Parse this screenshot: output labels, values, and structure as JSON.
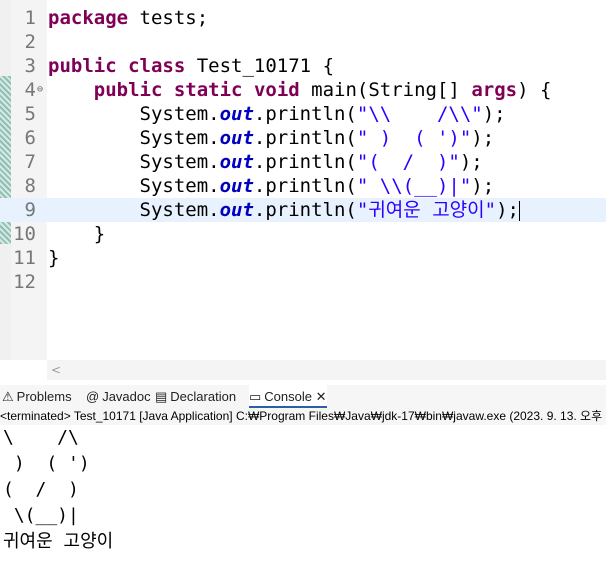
{
  "editor": {
    "lines": [
      {
        "num": "1",
        "tokens": [
          {
            "t": "package",
            "c": "kw"
          },
          {
            "t": " tests;"
          }
        ]
      },
      {
        "num": "2",
        "tokens": []
      },
      {
        "num": "3",
        "tokens": [
          {
            "t": "public",
            "c": "kw"
          },
          {
            "t": " "
          },
          {
            "t": "class",
            "c": "kw"
          },
          {
            "t": " Test_10171 {"
          }
        ]
      },
      {
        "num": "4",
        "fold": true,
        "tokens": [
          {
            "t": "    "
          },
          {
            "t": "public",
            "c": "kw"
          },
          {
            "t": " "
          },
          {
            "t": "static",
            "c": "kw"
          },
          {
            "t": " "
          },
          {
            "t": "void",
            "c": "kw"
          },
          {
            "t": " main(String[] "
          },
          {
            "t": "args",
            "c": "kw"
          },
          {
            "t": ") {"
          }
        ]
      },
      {
        "num": "5",
        "tokens": [
          {
            "t": "        System."
          },
          {
            "t": "out",
            "c": "fld"
          },
          {
            "t": ".println("
          },
          {
            "t": "\"\\\\    /\\\\\"",
            "c": "str"
          },
          {
            "t": ");"
          }
        ]
      },
      {
        "num": "6",
        "tokens": [
          {
            "t": "        System."
          },
          {
            "t": "out",
            "c": "fld"
          },
          {
            "t": ".println("
          },
          {
            "t": "\" )  ( ')\"",
            "c": "str"
          },
          {
            "t": ");"
          }
        ]
      },
      {
        "num": "7",
        "tokens": [
          {
            "t": "        System."
          },
          {
            "t": "out",
            "c": "fld"
          },
          {
            "t": ".println("
          },
          {
            "t": "\"(  /  )\"",
            "c": "str"
          },
          {
            "t": ");"
          }
        ]
      },
      {
        "num": "8",
        "tokens": [
          {
            "t": "        System."
          },
          {
            "t": "out",
            "c": "fld"
          },
          {
            "t": ".println("
          },
          {
            "t": "\" \\\\(__)|\"",
            "c": "str"
          },
          {
            "t": ");"
          }
        ]
      },
      {
        "num": "9",
        "current": true,
        "tokens": [
          {
            "t": "        System."
          },
          {
            "t": "out",
            "c": "fld"
          },
          {
            "t": ".println("
          },
          {
            "t": "\"귀여운 고양이\"",
            "c": "str"
          },
          {
            "t": ");"
          },
          {
            "caret": true
          }
        ]
      },
      {
        "num": "10",
        "tokens": [
          {
            "t": "    }"
          }
        ]
      },
      {
        "num": "11",
        "tokens": [
          {
            "t": "}"
          }
        ]
      },
      {
        "num": "12",
        "tokens": []
      }
    ],
    "scroll_left_glyph": "<"
  },
  "tabs": [
    {
      "icon": "⚠",
      "label": "Problems",
      "name": "problems-tab",
      "active": false
    },
    {
      "icon": "@",
      "label": "Javadoc",
      "name": "javadoc-tab",
      "active": false
    },
    {
      "icon": "▤",
      "label": "Declaration",
      "name": "declaration-tab",
      "active": false
    },
    {
      "icon": "▭",
      "label": "Console",
      "name": "console-tab",
      "active": true,
      "close": "✕"
    }
  ],
  "console": {
    "status": "<terminated> Test_10171 [Java Application] C:₩Program Files₩Java₩jdk-17₩bin₩javaw.exe  (2023. 9. 13. 오후",
    "output": [
      "\\    /\\",
      " )  ( ')",
      "(  /  )",
      " \\(__)|",
      "귀여운 고양이"
    ]
  },
  "colors": {
    "keyword": "#7f0055",
    "string": "#2a00ff",
    "field": "#0000c0",
    "current_line": "#e8f2fe",
    "active_tab": "#2d5ea8"
  }
}
